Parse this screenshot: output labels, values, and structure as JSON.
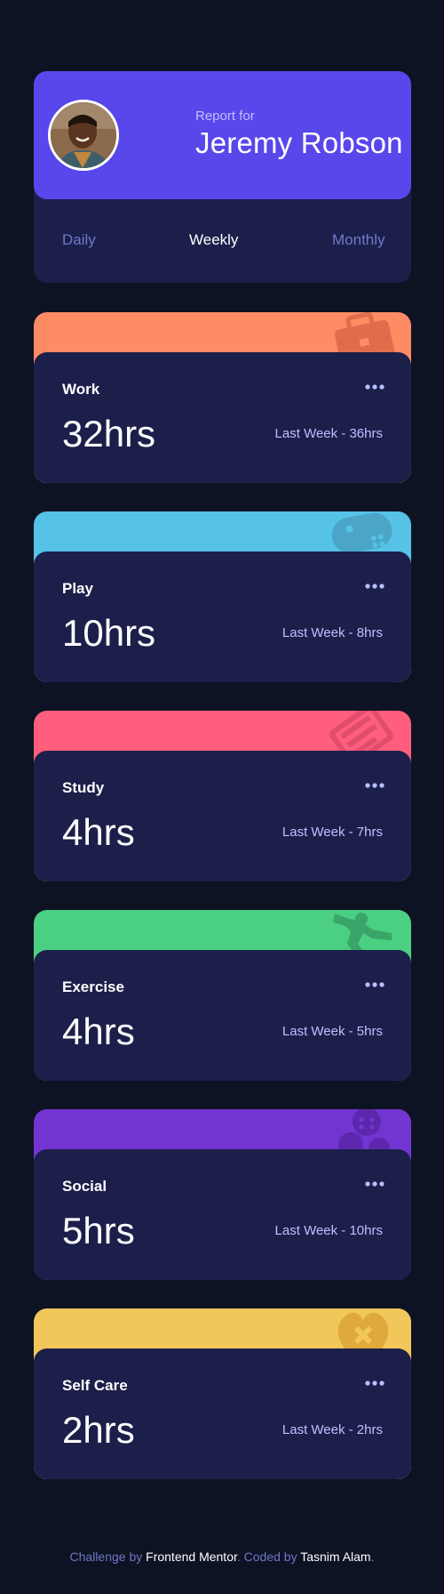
{
  "profile": {
    "report_for": "Report for",
    "name": "Jeremy Robson"
  },
  "periods": {
    "daily": "Daily",
    "weekly": "Weekly",
    "monthly": "Monthly",
    "selected": "Weekly"
  },
  "activities": [
    {
      "title": "Work",
      "hours": "32hrs",
      "last": "Last Week - 36hrs",
      "color": "#ff8b64",
      "icon": "briefcase-icon"
    },
    {
      "title": "Play",
      "hours": "10hrs",
      "last": "Last Week - 8hrs",
      "color": "#55c2e6",
      "icon": "gamepad-icon"
    },
    {
      "title": "Study",
      "hours": "4hrs",
      "last": "Last Week - 7hrs",
      "color": "#ff5e7d",
      "icon": "book-icon"
    },
    {
      "title": "Exercise",
      "hours": "4hrs",
      "last": "Last Week - 5hrs",
      "color": "#4bcf82",
      "icon": "running-icon"
    },
    {
      "title": "Social",
      "hours": "5hrs",
      "last": "Last Week - 10hrs",
      "color": "#7335d2",
      "icon": "social-icon"
    },
    {
      "title": "Self Care",
      "hours": "2hrs",
      "last": "Last Week - 2hrs",
      "color": "#f1c75b",
      "icon": "heart-icon"
    }
  ],
  "footer": {
    "prefix": "Challenge by",
    "org": "Frontend Mentor",
    "mid": ". Coded by",
    "author": "Tasnim Alam",
    "suffix": "."
  }
}
